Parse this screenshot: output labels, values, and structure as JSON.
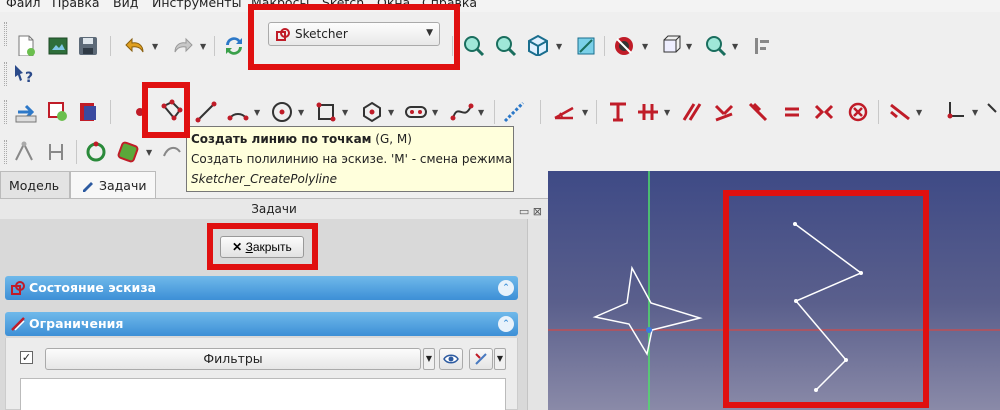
{
  "menubar": [
    "Файл",
    "Правка",
    "Вид",
    "Инструменты",
    "Макросы",
    "Sketch",
    "Окна",
    "Справка"
  ],
  "workbench": {
    "selected": "Sketcher",
    "icon": "sketcher-workbench-icon"
  },
  "tooltip": {
    "title": "Создать линию по точкам",
    "shortcut": " (G, M)",
    "description": "Создать полилинию на эскизе. 'M' - смена режима",
    "command": "Sketcher_CreatePolyline"
  },
  "tabs": {
    "model": "Модель",
    "tasks": "Задачи"
  },
  "task_panel": {
    "title": "Задачи",
    "close_label": "Закрыть",
    "close_mnemonic": "З",
    "close_rest": "акрыть",
    "section_state": "Состояние эскиза",
    "section_constraints": "Ограничения",
    "filter_label": "Фильтры",
    "filter_checked": true
  },
  "colors": {
    "highlight": "#e01010",
    "section_header": "#4a9be0",
    "tooltip_bg": "#ffffdc",
    "view_top": "#3e4a86",
    "view_bottom": "#8a8aa8",
    "axis_green": "#4ee06a",
    "axis_red": "#d04a4a",
    "sketch_line": "#ffffff",
    "tool_red": "#b01f28"
  }
}
